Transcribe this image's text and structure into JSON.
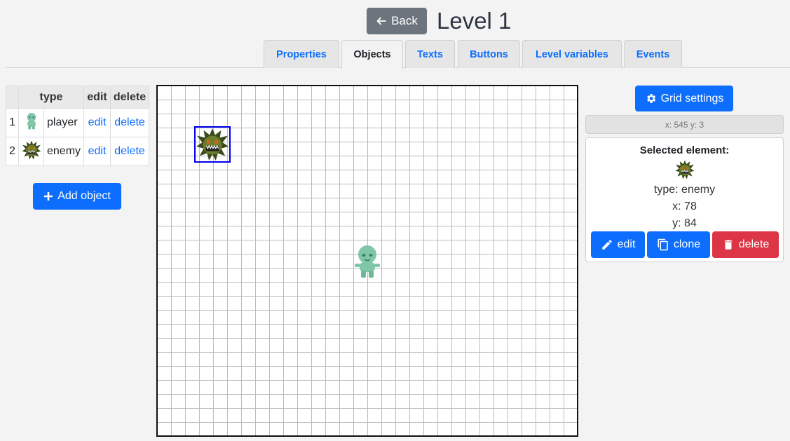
{
  "header": {
    "back_label": "Back",
    "title": "Level 1"
  },
  "tabs": [
    {
      "label": "Properties",
      "active": false
    },
    {
      "label": "Objects",
      "active": true
    },
    {
      "label": "Texts",
      "active": false
    },
    {
      "label": "Buttons",
      "active": false
    },
    {
      "label": "Level variables",
      "active": false
    },
    {
      "label": "Events",
      "active": false
    }
  ],
  "objects_table": {
    "headers": {
      "num": "",
      "icon": "",
      "type": "type",
      "edit": "edit",
      "delete": "delete"
    },
    "rows": [
      {
        "num": "1",
        "icon": "player-icon",
        "type": "player",
        "edit": "edit",
        "delete": "delete"
      },
      {
        "num": "2",
        "icon": "enemy-icon",
        "type": "enemy",
        "edit": "edit",
        "delete": "delete"
      }
    ]
  },
  "add_object_label": "Add object",
  "grid_settings_label": "Grid settings",
  "cursor_coords": "x: 545 y: 3",
  "selected": {
    "title": "Selected element:",
    "icon": "enemy-icon",
    "type_line": "type: enemy",
    "x_line": "x: 78",
    "y_line": "y: 84",
    "edit_label": "edit",
    "clone_label": "clone",
    "delete_label": "delete"
  },
  "colors": {
    "primary": "#0d6efd",
    "secondary": "#6c757d",
    "danger": "#dc3545",
    "selection": "#0000ee"
  }
}
